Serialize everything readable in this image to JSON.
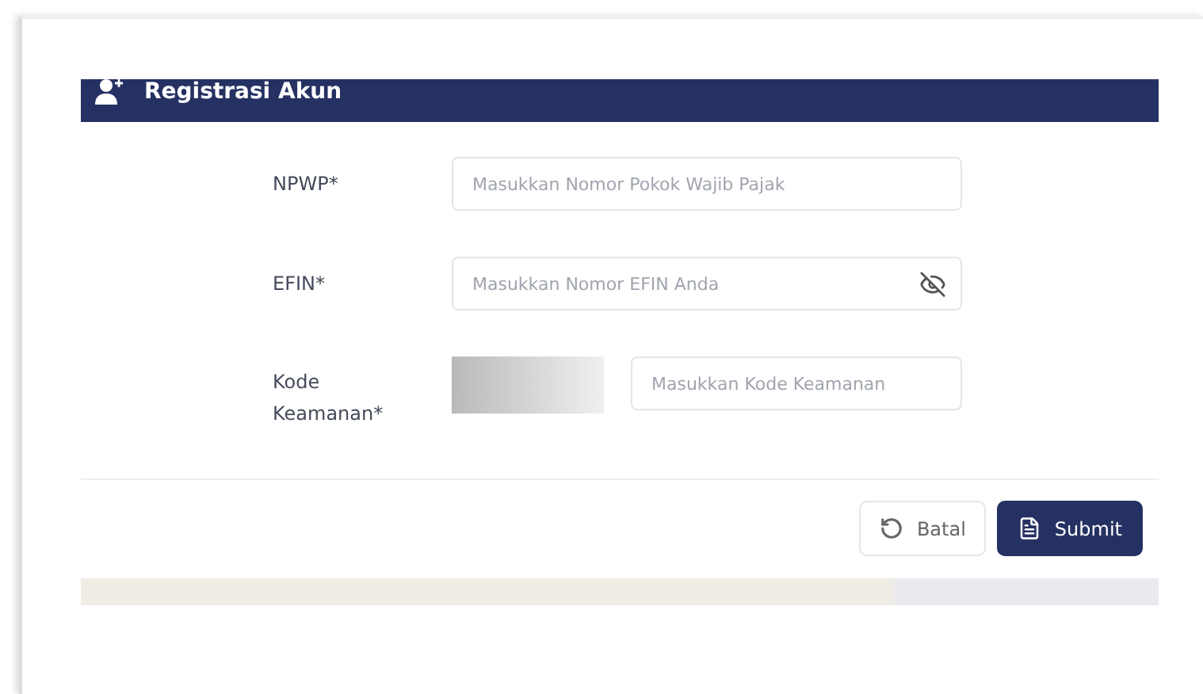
{
  "header": {
    "title": "Registrasi Akun"
  },
  "fields": [
    {
      "kind": "text",
      "label": "NPWP*",
      "placeholder": "Masukkan Nomor Pokok Wajib Pajak"
    },
    {
      "kind": "password",
      "label": "EFIN*",
      "placeholder": "Masukkan Nomor EFIN Anda"
    },
    {
      "kind": "captcha",
      "label": "Kode Keamanan*",
      "placeholder": "Masukkan Kode Keamanan"
    }
  ],
  "buttons": [
    {
      "kind": "reset",
      "label": "Batal"
    },
    {
      "kind": "submit",
      "label": "Submit"
    }
  ]
}
